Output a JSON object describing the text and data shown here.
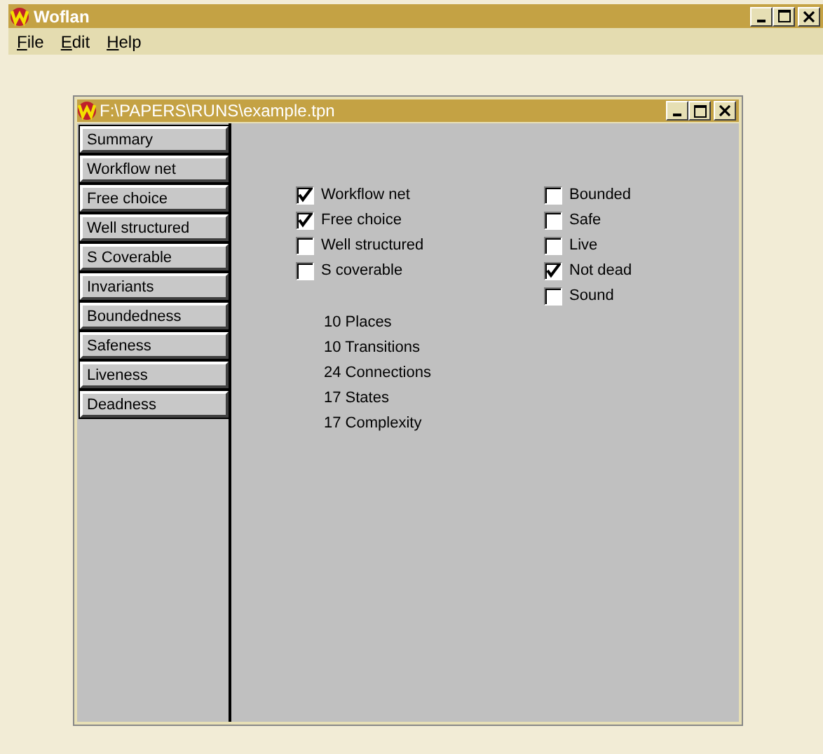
{
  "window": {
    "title": "Woflan"
  },
  "menu": [
    "File",
    "Edit",
    "Help"
  ],
  "document": {
    "title": "F:\\PAPERS\\RUNS\\example.tpn",
    "sidebar": [
      "Summary",
      "Workflow net",
      "Free choice",
      "Well structured",
      "S Coverable",
      "Invariants",
      "Boundedness",
      "Safeness",
      "Liveness",
      "Deadness"
    ],
    "properties_left": [
      {
        "label": "Workflow net",
        "checked": true
      },
      {
        "label": "Free choice",
        "checked": true
      },
      {
        "label": "Well structured",
        "checked": false
      },
      {
        "label": "S coverable",
        "checked": false
      }
    ],
    "properties_right": [
      {
        "label": "Bounded",
        "checked": false
      },
      {
        "label": "Safe",
        "checked": false
      },
      {
        "label": "Live",
        "checked": false
      },
      {
        "label": "Not dead",
        "checked": true
      },
      {
        "label": "Sound",
        "checked": false
      }
    ],
    "statistics": [
      "10 Places",
      "10 Transitions",
      "24 Connections",
      "17 States",
      "17 Complexity"
    ]
  }
}
